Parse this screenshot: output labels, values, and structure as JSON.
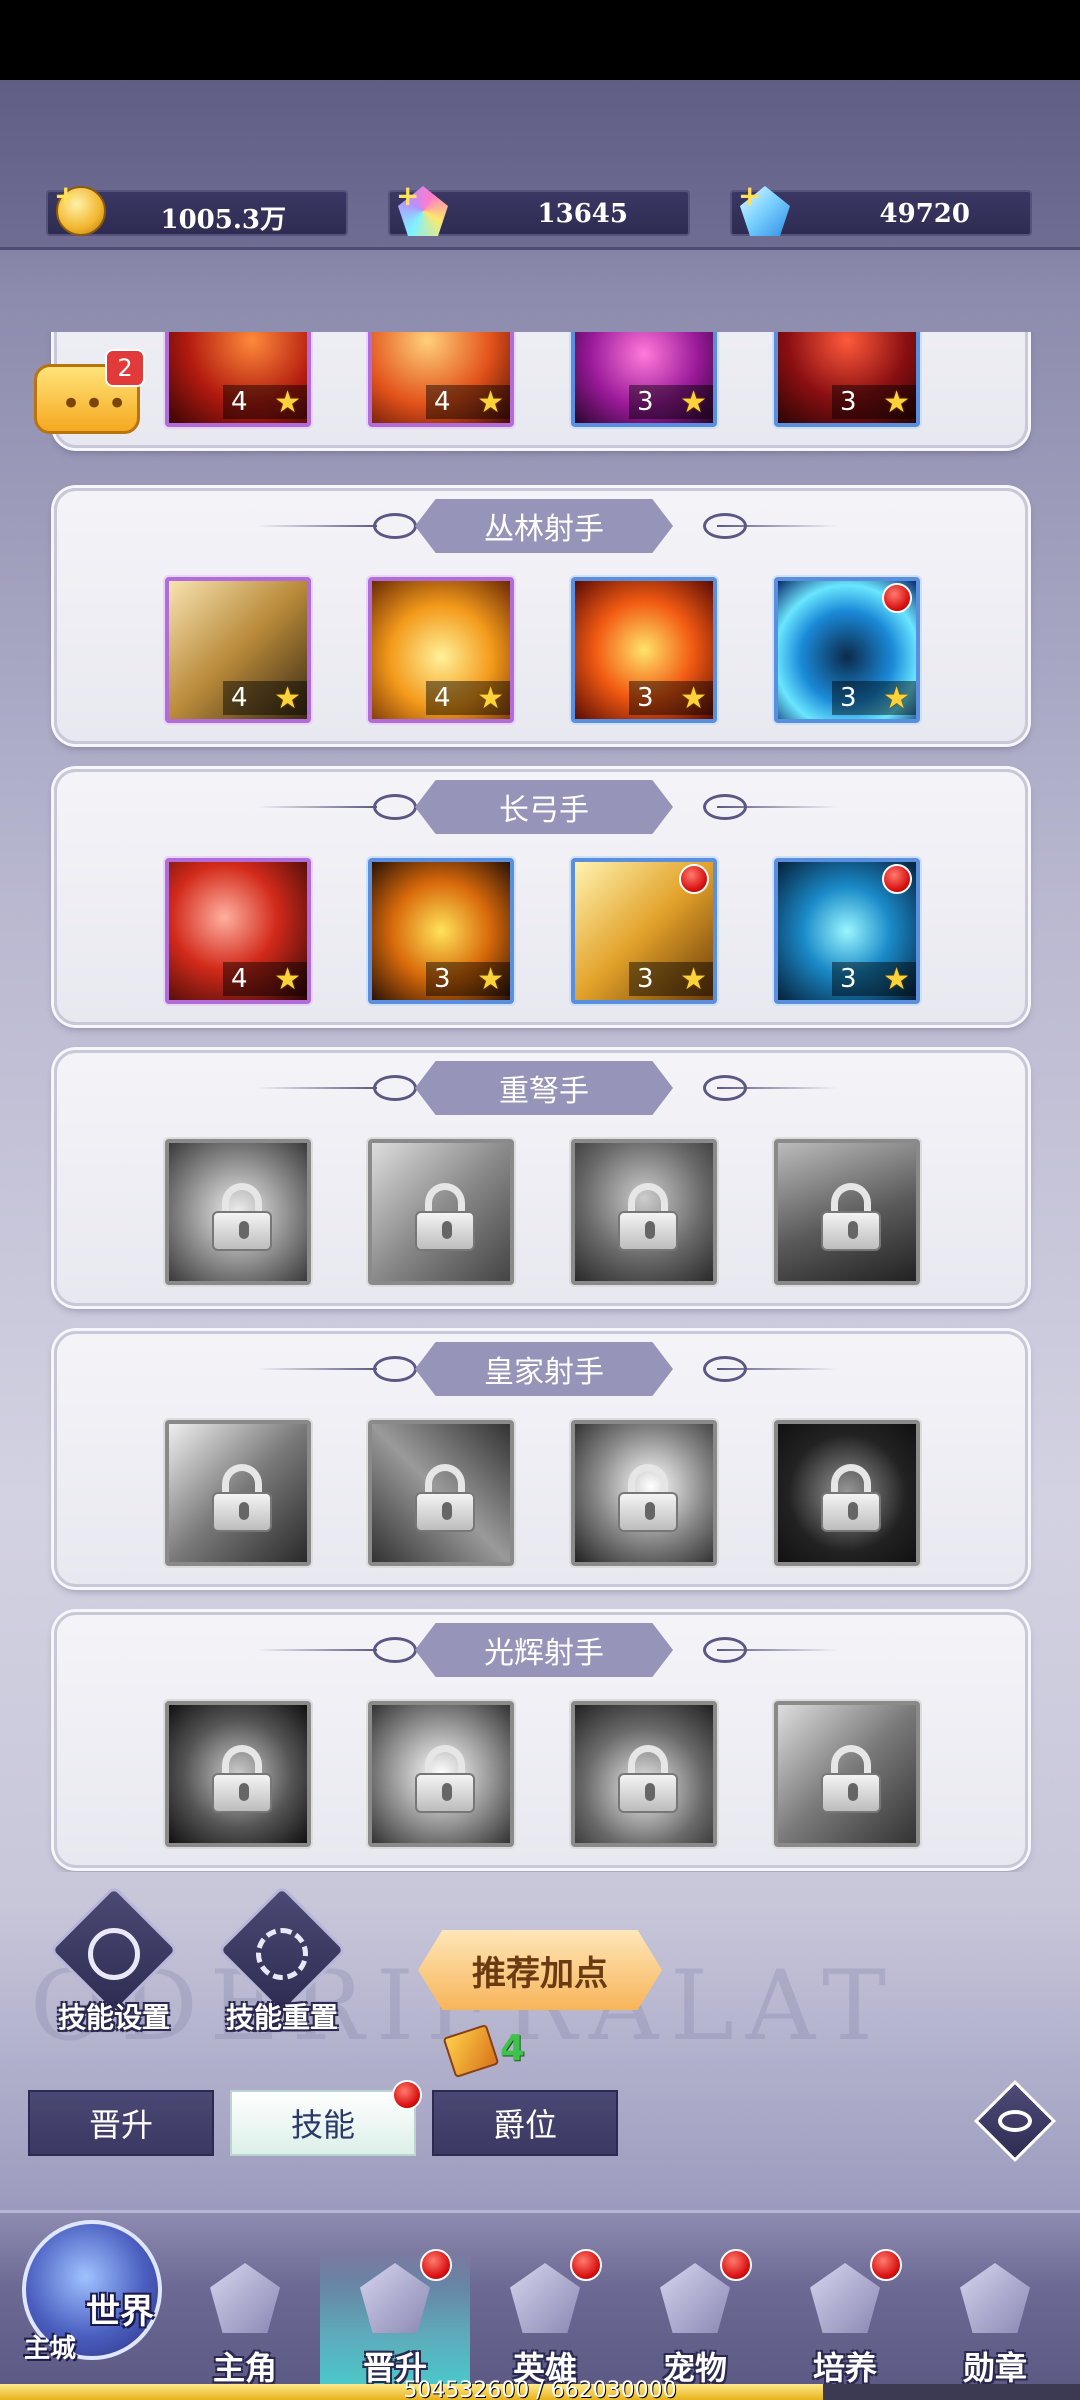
{
  "currencies": [
    {
      "name": "gold",
      "value": "1005.3万"
    },
    {
      "name": "rainbow-gem",
      "value": "13645"
    },
    {
      "name": "diamond",
      "value": "49720"
    }
  ],
  "chat": {
    "badge": "2",
    "dots": "•••"
  },
  "watermark": "ODERIFRALAT",
  "top_partial_row": [
    {
      "level": "4",
      "star": "★"
    },
    {
      "level": "4",
      "star": "★"
    },
    {
      "level": "3",
      "star": "★"
    },
    {
      "level": "3",
      "star": "★"
    }
  ],
  "classes": [
    {
      "title": "丛林射手",
      "skills": [
        {
          "level": "4",
          "star": "★",
          "locked": false,
          "dot": false
        },
        {
          "level": "4",
          "star": "★",
          "locked": false,
          "dot": false
        },
        {
          "level": "3",
          "star": "★",
          "locked": false,
          "dot": false
        },
        {
          "level": "3",
          "star": "★",
          "locked": false,
          "dot": true
        }
      ]
    },
    {
      "title": "长弓手",
      "skills": [
        {
          "level": "4",
          "star": "★",
          "locked": false,
          "dot": false
        },
        {
          "level": "3",
          "star": "★",
          "locked": false,
          "dot": false
        },
        {
          "level": "3",
          "star": "★",
          "locked": false,
          "dot": true
        },
        {
          "level": "3",
          "star": "★",
          "locked": false,
          "dot": true
        }
      ]
    },
    {
      "title": "重弩手",
      "skills": [
        {
          "locked": true
        },
        {
          "locked": true
        },
        {
          "locked": true
        },
        {
          "locked": true
        }
      ]
    },
    {
      "title": "皇家射手",
      "skills": [
        {
          "locked": true
        },
        {
          "locked": true
        },
        {
          "locked": true
        },
        {
          "locked": true
        }
      ]
    },
    {
      "title": "光辉射手",
      "skills": [
        {
          "locked": true
        },
        {
          "locked": true
        },
        {
          "locked": true
        },
        {
          "locked": true
        }
      ]
    }
  ],
  "actions": {
    "skill_settings": "技能设置",
    "skill_reset": "技能重置",
    "recommend": "推荐加点",
    "book_count": "4"
  },
  "tabs": [
    {
      "label": "晋升",
      "active": false
    },
    {
      "label": "技能",
      "active": true
    },
    {
      "label": "爵位",
      "active": false
    }
  ],
  "nav": {
    "world": "世界",
    "main_city": "主城",
    "items": [
      {
        "label": "主角",
        "active": false,
        "dot": false
      },
      {
        "label": "晋升",
        "active": true,
        "dot": true
      },
      {
        "label": "英雄",
        "active": false,
        "dot": true
      },
      {
        "label": "宠物",
        "active": false,
        "dot": true
      },
      {
        "label": "培养",
        "active": false,
        "dot": true
      },
      {
        "label": "勋章",
        "active": false,
        "dot": false
      }
    ]
  },
  "exp": {
    "text": "504532600 / 662030000",
    "current": 504532600,
    "max": 662030000
  },
  "colors": {
    "accent": "#9694b8",
    "epic": "#b06cd8",
    "rare": "#5a8fe0",
    "badge": "#d80f0f"
  }
}
